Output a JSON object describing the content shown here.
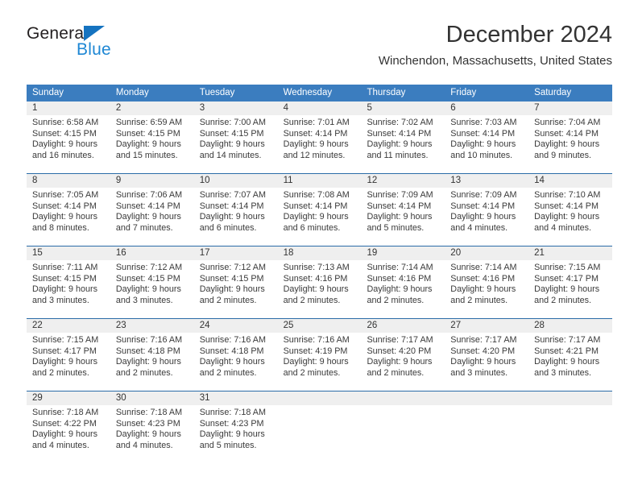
{
  "logo": {
    "word_one": "General",
    "word_two": "Blue",
    "triangle_color": "#1573c0",
    "blue_text_color": "#1e87d4"
  },
  "header": {
    "title": "December 2024",
    "location": "Winchendon, Massachusetts, United States"
  },
  "colors": {
    "header_blue": "#3b7dbf",
    "row_rule": "#2b6ca8",
    "daynum_band": "#efefef"
  },
  "calendar": {
    "weekday_headers": [
      "Sunday",
      "Monday",
      "Tuesday",
      "Wednesday",
      "Thursday",
      "Friday",
      "Saturday"
    ],
    "weeks": [
      [
        {
          "day": "1",
          "lines": [
            "Sunrise: 6:58 AM",
            "Sunset: 4:15 PM",
            "Daylight: 9 hours",
            "and 16 minutes."
          ]
        },
        {
          "day": "2",
          "lines": [
            "Sunrise: 6:59 AM",
            "Sunset: 4:15 PM",
            "Daylight: 9 hours",
            "and 15 minutes."
          ]
        },
        {
          "day": "3",
          "lines": [
            "Sunrise: 7:00 AM",
            "Sunset: 4:15 PM",
            "Daylight: 9 hours",
            "and 14 minutes."
          ]
        },
        {
          "day": "4",
          "lines": [
            "Sunrise: 7:01 AM",
            "Sunset: 4:14 PM",
            "Daylight: 9 hours",
            "and 12 minutes."
          ]
        },
        {
          "day": "5",
          "lines": [
            "Sunrise: 7:02 AM",
            "Sunset: 4:14 PM",
            "Daylight: 9 hours",
            "and 11 minutes."
          ]
        },
        {
          "day": "6",
          "lines": [
            "Sunrise: 7:03 AM",
            "Sunset: 4:14 PM",
            "Daylight: 9 hours",
            "and 10 minutes."
          ]
        },
        {
          "day": "7",
          "lines": [
            "Sunrise: 7:04 AM",
            "Sunset: 4:14 PM",
            "Daylight: 9 hours",
            "and 9 minutes."
          ]
        }
      ],
      [
        {
          "day": "8",
          "lines": [
            "Sunrise: 7:05 AM",
            "Sunset: 4:14 PM",
            "Daylight: 9 hours",
            "and 8 minutes."
          ]
        },
        {
          "day": "9",
          "lines": [
            "Sunrise: 7:06 AM",
            "Sunset: 4:14 PM",
            "Daylight: 9 hours",
            "and 7 minutes."
          ]
        },
        {
          "day": "10",
          "lines": [
            "Sunrise: 7:07 AM",
            "Sunset: 4:14 PM",
            "Daylight: 9 hours",
            "and 6 minutes."
          ]
        },
        {
          "day": "11",
          "lines": [
            "Sunrise: 7:08 AM",
            "Sunset: 4:14 PM",
            "Daylight: 9 hours",
            "and 6 minutes."
          ]
        },
        {
          "day": "12",
          "lines": [
            "Sunrise: 7:09 AM",
            "Sunset: 4:14 PM",
            "Daylight: 9 hours",
            "and 5 minutes."
          ]
        },
        {
          "day": "13",
          "lines": [
            "Sunrise: 7:09 AM",
            "Sunset: 4:14 PM",
            "Daylight: 9 hours",
            "and 4 minutes."
          ]
        },
        {
          "day": "14",
          "lines": [
            "Sunrise: 7:10 AM",
            "Sunset: 4:14 PM",
            "Daylight: 9 hours",
            "and 4 minutes."
          ]
        }
      ],
      [
        {
          "day": "15",
          "lines": [
            "Sunrise: 7:11 AM",
            "Sunset: 4:15 PM",
            "Daylight: 9 hours",
            "and 3 minutes."
          ]
        },
        {
          "day": "16",
          "lines": [
            "Sunrise: 7:12 AM",
            "Sunset: 4:15 PM",
            "Daylight: 9 hours",
            "and 3 minutes."
          ]
        },
        {
          "day": "17",
          "lines": [
            "Sunrise: 7:12 AM",
            "Sunset: 4:15 PM",
            "Daylight: 9 hours",
            "and 2 minutes."
          ]
        },
        {
          "day": "18",
          "lines": [
            "Sunrise: 7:13 AM",
            "Sunset: 4:16 PM",
            "Daylight: 9 hours",
            "and 2 minutes."
          ]
        },
        {
          "day": "19",
          "lines": [
            "Sunrise: 7:14 AM",
            "Sunset: 4:16 PM",
            "Daylight: 9 hours",
            "and 2 minutes."
          ]
        },
        {
          "day": "20",
          "lines": [
            "Sunrise: 7:14 AM",
            "Sunset: 4:16 PM",
            "Daylight: 9 hours",
            "and 2 minutes."
          ]
        },
        {
          "day": "21",
          "lines": [
            "Sunrise: 7:15 AM",
            "Sunset: 4:17 PM",
            "Daylight: 9 hours",
            "and 2 minutes."
          ]
        }
      ],
      [
        {
          "day": "22",
          "lines": [
            "Sunrise: 7:15 AM",
            "Sunset: 4:17 PM",
            "Daylight: 9 hours",
            "and 2 minutes."
          ]
        },
        {
          "day": "23",
          "lines": [
            "Sunrise: 7:16 AM",
            "Sunset: 4:18 PM",
            "Daylight: 9 hours",
            "and 2 minutes."
          ]
        },
        {
          "day": "24",
          "lines": [
            "Sunrise: 7:16 AM",
            "Sunset: 4:18 PM",
            "Daylight: 9 hours",
            "and 2 minutes."
          ]
        },
        {
          "day": "25",
          "lines": [
            "Sunrise: 7:16 AM",
            "Sunset: 4:19 PM",
            "Daylight: 9 hours",
            "and 2 minutes."
          ]
        },
        {
          "day": "26",
          "lines": [
            "Sunrise: 7:17 AM",
            "Sunset: 4:20 PM",
            "Daylight: 9 hours",
            "and 2 minutes."
          ]
        },
        {
          "day": "27",
          "lines": [
            "Sunrise: 7:17 AM",
            "Sunset: 4:20 PM",
            "Daylight: 9 hours",
            "and 3 minutes."
          ]
        },
        {
          "day": "28",
          "lines": [
            "Sunrise: 7:17 AM",
            "Sunset: 4:21 PM",
            "Daylight: 9 hours",
            "and 3 minutes."
          ]
        }
      ],
      [
        {
          "day": "29",
          "lines": [
            "Sunrise: 7:18 AM",
            "Sunset: 4:22 PM",
            "Daylight: 9 hours",
            "and 4 minutes."
          ]
        },
        {
          "day": "30",
          "lines": [
            "Sunrise: 7:18 AM",
            "Sunset: 4:23 PM",
            "Daylight: 9 hours",
            "and 4 minutes."
          ]
        },
        {
          "day": "31",
          "lines": [
            "Sunrise: 7:18 AM",
            "Sunset: 4:23 PM",
            "Daylight: 9 hours",
            "and 5 minutes."
          ]
        },
        {
          "day": "",
          "lines": []
        },
        {
          "day": "",
          "lines": []
        },
        {
          "day": "",
          "lines": []
        },
        {
          "day": "",
          "lines": []
        }
      ]
    ]
  }
}
